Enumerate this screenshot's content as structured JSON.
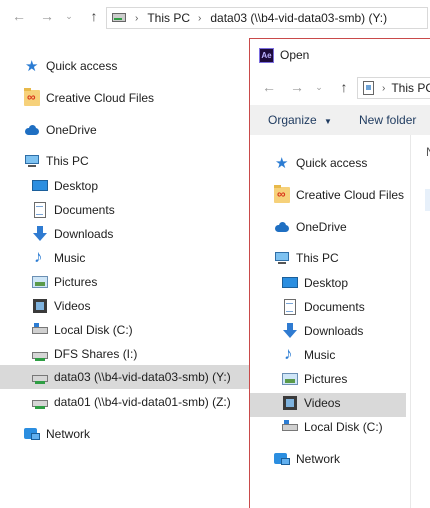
{
  "background_explorer": {
    "address_crumbs": [
      "This PC",
      "data03 (\\\\b4-vid-data03-smb) (Y:)"
    ],
    "tree": [
      {
        "label": "Quick access",
        "icon": "star-icon"
      },
      {
        "label": "Creative Cloud Files",
        "icon": "creative-cloud-folder-icon"
      },
      {
        "label": "OneDrive",
        "icon": "cloud-icon"
      },
      {
        "label": "This PC",
        "icon": "computer-icon"
      },
      {
        "label": "Desktop",
        "icon": "desktop-icon"
      },
      {
        "label": "Documents",
        "icon": "documents-icon"
      },
      {
        "label": "Downloads",
        "icon": "download-icon"
      },
      {
        "label": "Music",
        "icon": "music-icon"
      },
      {
        "label": "Pictures",
        "icon": "pictures-icon"
      },
      {
        "label": "Videos",
        "icon": "videos-icon"
      },
      {
        "label": "Local Disk (C:)",
        "icon": "local-disk-icon"
      },
      {
        "label": "DFS Shares (I:)",
        "icon": "network-drive-icon"
      },
      {
        "label": "data03 (\\\\b4-vid-data03-smb) (Y:)",
        "icon": "network-drive-icon",
        "selected": true
      },
      {
        "label": "data01 (\\\\b4-vid-data01-smb) (Z:)",
        "icon": "network-drive-icon"
      },
      {
        "label": "Network",
        "icon": "network-icon"
      }
    ]
  },
  "open_dialog": {
    "app_icon_text": "Ae",
    "title": "Open",
    "address_crumbs": [
      "This PC"
    ],
    "commands": {
      "organize": "Organize",
      "new_folder": "New folder"
    },
    "right_pane_fragment": "N",
    "tree": [
      {
        "label": "Quick access",
        "icon": "star-icon"
      },
      {
        "label": "Creative Cloud Files",
        "icon": "creative-cloud-folder-icon"
      },
      {
        "label": "OneDrive",
        "icon": "cloud-icon"
      },
      {
        "label": "This PC",
        "icon": "computer-icon"
      },
      {
        "label": "Desktop",
        "icon": "desktop-icon"
      },
      {
        "label": "Documents",
        "icon": "documents-icon",
        "selected": true
      },
      {
        "label": "Downloads",
        "icon": "download-icon"
      },
      {
        "label": "Music",
        "icon": "music-icon"
      },
      {
        "label": "Pictures",
        "icon": "pictures-icon"
      },
      {
        "label": "Videos",
        "icon": "videos-icon"
      },
      {
        "label": "Local Disk (C:)",
        "icon": "local-disk-icon"
      },
      {
        "label": "Network",
        "icon": "network-icon"
      }
    ]
  }
}
